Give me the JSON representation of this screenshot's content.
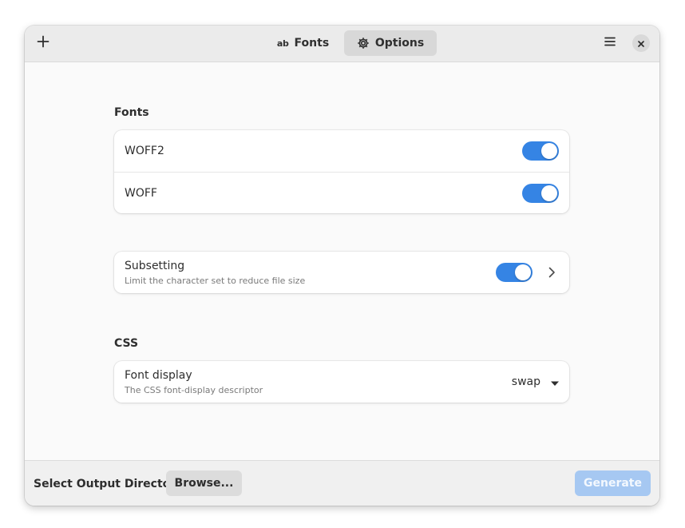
{
  "headerbar": {
    "tabs": [
      {
        "label": "Fonts",
        "icon": "ab-text-icon",
        "icon_text": "ab",
        "active": false
      },
      {
        "label": "Options",
        "icon": "gear-icon",
        "active": true
      }
    ],
    "buttons": {
      "add": "plus-icon",
      "menu": "hamburger-menu-icon",
      "close": "close-icon"
    }
  },
  "fonts_section": {
    "title": "Fonts",
    "rows": [
      {
        "label": "WOFF2",
        "enabled": true
      },
      {
        "label": "WOFF",
        "enabled": true
      }
    ]
  },
  "subsetting": {
    "title": "Subsetting",
    "subtitle": "Limit the character set to reduce file size",
    "enabled": true
  },
  "css_section": {
    "title": "CSS",
    "font_display": {
      "title": "Font display",
      "subtitle": "The CSS font-display descriptor",
      "value": "swap"
    }
  },
  "bottombar": {
    "label": "Select Output Directory",
    "browse": "Browse...",
    "generate": "Generate",
    "generate_enabled": false
  },
  "colors": {
    "accent": "#3584e4",
    "generate_disabled": "#a6c8f2",
    "headerbar": "#ebebeb"
  }
}
